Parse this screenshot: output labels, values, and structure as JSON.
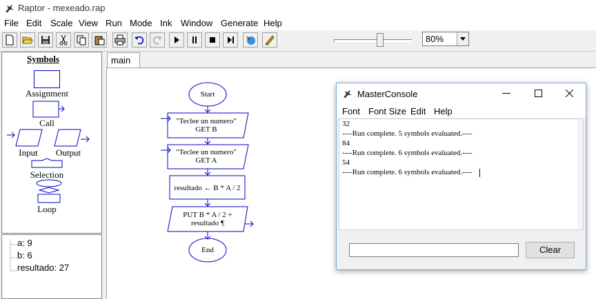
{
  "window": {
    "title": "Raptor - mexeado.rap"
  },
  "menubar": [
    "File",
    "Edit",
    "Scale",
    "View",
    "Run",
    "Mode",
    "Ink",
    "Window",
    "Generate",
    "Help"
  ],
  "toolbar": {
    "buttons": [
      "new-icon",
      "open-icon",
      "save-icon",
      "cut-icon",
      "copy-icon",
      "paste-icon",
      "print-icon",
      "undo-icon",
      "redo-icon",
      "play-icon",
      "pause-icon",
      "stop-icon",
      "step-icon",
      "test-icon",
      "pen-icon"
    ],
    "zoom": "80%"
  },
  "symbols": {
    "title": "Symbols",
    "assignment": "Assignment",
    "call": "Call",
    "input": "Input",
    "output": "Output",
    "selection": "Selection",
    "loop": "Loop"
  },
  "variables": [
    {
      "text": "a: 9"
    },
    {
      "text": "b: 6"
    },
    {
      "text": "resultado: 27"
    }
  ],
  "tabs": {
    "main": "main"
  },
  "flowchart": {
    "start": "Start",
    "input1_line1": "\"Teclee un numero\"",
    "input1_line2": "GET B",
    "input2_line1": "\"Teclee un numero\"",
    "input2_line2": "GET A",
    "assign": "resultado  ← B * A / 2",
    "output_line1": "PUT B * A / 2 +",
    "output_line2": "resultado ¶",
    "end": "End"
  },
  "console": {
    "title": "MasterConsole",
    "menu": [
      "Font",
      "Font Size",
      "Edit",
      "Help"
    ],
    "output": [
      "32",
      "----Run complete.  5 symbols evaluated.----",
      "84",
      "----Run complete.  6 symbols evaluated.----",
      "54",
      "----Run complete.  6 symbols evaluated.----"
    ],
    "clear_label": "Clear"
  },
  "colors": {
    "flowchart_stroke": "#0000c8",
    "app_bg": "#f0f0f0"
  }
}
